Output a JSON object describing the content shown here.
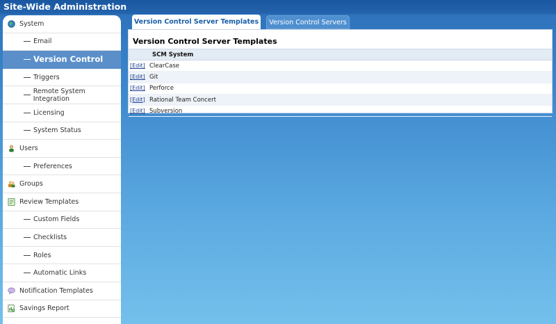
{
  "app": {
    "title": "Site-Wide Administration"
  },
  "sidebar": {
    "items": [
      {
        "label": "System",
        "level": "top",
        "icon": "globe-icon",
        "active": false
      },
      {
        "label": "Email",
        "level": "sub",
        "active": false
      },
      {
        "label": "Version Control",
        "level": "sub",
        "active": true
      },
      {
        "label": "Triggers",
        "level": "sub",
        "active": false
      },
      {
        "label": "Remote System Integration",
        "level": "sub",
        "active": false
      },
      {
        "label": "Licensing",
        "level": "sub",
        "active": false
      },
      {
        "label": "System Status",
        "level": "sub",
        "active": false
      },
      {
        "label": "Users",
        "level": "top",
        "icon": "user-icon",
        "active": false
      },
      {
        "label": "Preferences",
        "level": "sub",
        "active": false
      },
      {
        "label": "Groups",
        "level": "top",
        "icon": "group-icon",
        "active": false
      },
      {
        "label": "Review Templates",
        "level": "top",
        "icon": "template-icon",
        "active": false
      },
      {
        "label": "Custom Fields",
        "level": "sub",
        "active": false
      },
      {
        "label": "Checklists",
        "level": "sub",
        "active": false
      },
      {
        "label": "Roles",
        "level": "sub",
        "active": false
      },
      {
        "label": "Automatic Links",
        "level": "sub",
        "active": false
      },
      {
        "label": "Notification Templates",
        "level": "top",
        "icon": "speech-bubble-icon",
        "active": false
      },
      {
        "label": "Savings Report",
        "level": "top",
        "icon": "report-icon",
        "active": false
      }
    ]
  },
  "tabs": [
    {
      "label": "Version Control Server Templates",
      "active": true
    },
    {
      "label": "Version Control Servers",
      "active": false
    }
  ],
  "panel": {
    "title": "Version Control Server Templates",
    "column_header": "SCM System",
    "edit_label": "[Edit]",
    "rows": [
      "ClearCase",
      "Git",
      "Perforce",
      "Rational Team Concert",
      "Subversion"
    ]
  },
  "colors": {
    "header_blue": "#1f5fa8",
    "active_nav": "#5b8fc9",
    "tab_active_text": "#1a5fa8",
    "tab_inactive_bg": "#4f8fd0",
    "link": "#1a3d8f"
  }
}
